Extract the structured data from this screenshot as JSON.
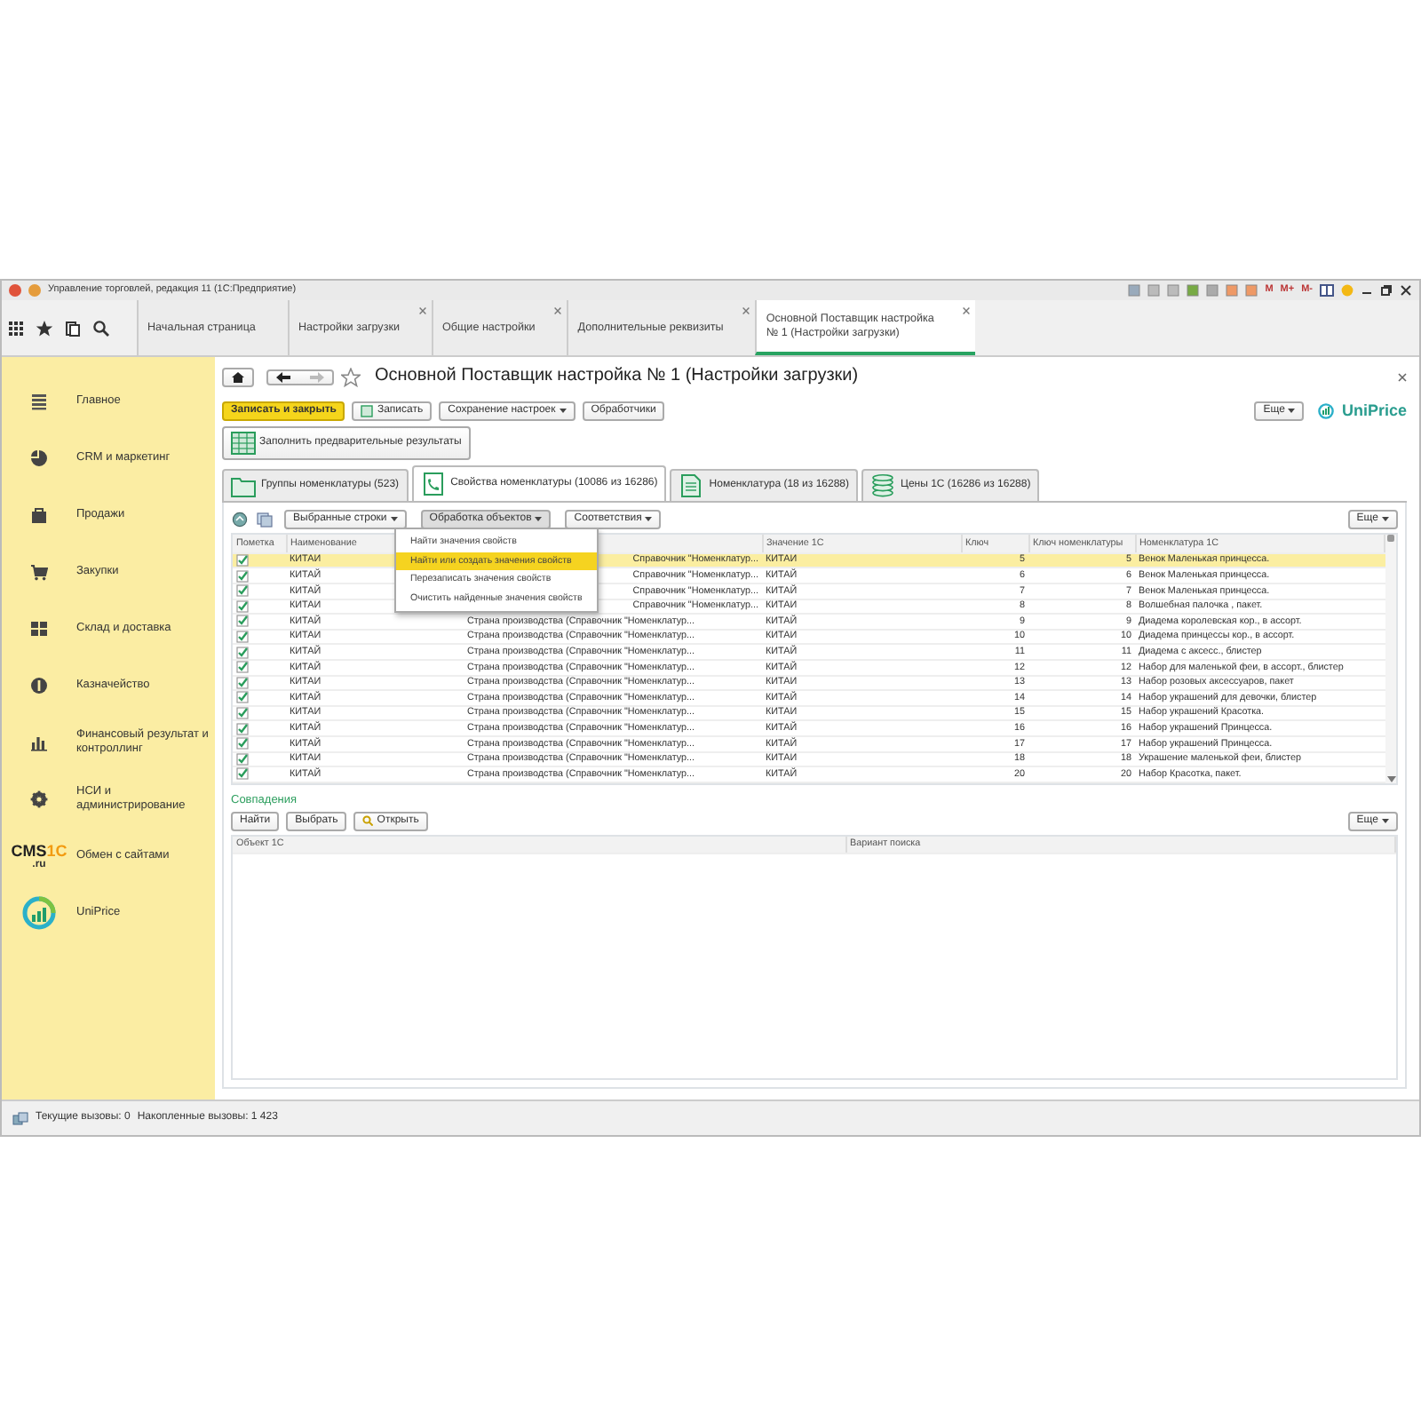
{
  "window": {
    "title": "Управление торговлей, редакция 11  (1С:Предприятие)",
    "tools": [
      "M",
      "M+",
      "M-"
    ]
  },
  "tabs": [
    {
      "label": "Начальная страница",
      "selected": false,
      "closable": false
    },
    {
      "label": "Настройки загрузки",
      "selected": false,
      "closable": true
    },
    {
      "label": "Общие настройки",
      "selected": false,
      "closable": true
    },
    {
      "label": "Дополнительные реквизиты",
      "selected": false,
      "closable": true
    },
    {
      "label": "Основной Поставщик настройка № 1 (Настройки загрузки)",
      "selected": true,
      "closable": true
    }
  ],
  "sidebar": {
    "items": [
      {
        "label": "Главное",
        "kind": "list"
      },
      {
        "label": "CRM и маркетинг",
        "kind": "pie"
      },
      {
        "label": "Продажи",
        "kind": "bag"
      },
      {
        "label": "Закупки",
        "kind": "cart"
      },
      {
        "label": "Склад и доставка",
        "kind": "grid"
      },
      {
        "label": "Казначейство",
        "kind": "coin"
      },
      {
        "label": "Финансовый результат и контроллинг",
        "kind": "bars"
      },
      {
        "label": "НСИ и администрирование",
        "kind": "gear"
      },
      {
        "label": "Обмен с сайтами",
        "kind": "cms",
        "logo": {
          "main": "CMS",
          "accent": "1C",
          "sub": ".ru"
        }
      },
      {
        "label": "UniPrice",
        "kind": "uniprice"
      }
    ]
  },
  "form": {
    "title": "Основной Поставщик настройка № 1 (Настройки загрузки)",
    "buttons": [
      {
        "label": "Записать и закрыть",
        "kind": "primary"
      },
      {
        "label": "Записать",
        "kind": "save"
      },
      {
        "label": "Сохранение настроек",
        "kind": "dropdown"
      },
      {
        "label": "Обработчики",
        "kind": "plain"
      }
    ],
    "more": "Еще",
    "brand": "UniPrice",
    "fill_button": "Заполнить предварительные результаты",
    "inner_tabs": [
      {
        "label": "Группы номенклатуры (523)",
        "kind": "folder",
        "selected": false
      },
      {
        "label": "Свойства номенклатуры (10086 из 16286)",
        "kind": "phone",
        "selected": true
      },
      {
        "label": "Номенклатура (18 из 16288)",
        "kind": "doc",
        "selected": false
      },
      {
        "label": "Цены 1С (16286 из 16288)",
        "kind": "coins",
        "selected": false
      }
    ]
  },
  "table_toolbar": {
    "buttons": [
      {
        "label": "Выбранные строки",
        "pressed": false
      },
      {
        "label": "Обработка объектов",
        "pressed": true
      },
      {
        "label": "Соответствия",
        "pressed": false
      }
    ],
    "more": "Еще"
  },
  "menu": {
    "items": [
      {
        "label": "Найти значения свойств",
        "selected": false
      },
      {
        "label": "Найти или создать значения свойств",
        "selected": true
      },
      {
        "label": "Перезаписать значения свойств",
        "selected": false
      },
      {
        "label": "Очистить найденные значения свойств",
        "selected": false
      }
    ]
  },
  "table": {
    "columns": [
      "Пометка",
      "Наименование",
      "",
      "Значение 1С",
      "Ключ",
      "Ключ номенклатуры",
      "Номенклатура 1С"
    ],
    "rows": [
      {
        "checked": true,
        "selected": true,
        "name": "КИТАЙ",
        "column_3": "Справочник \"Номенклатур...",
        "covered": true,
        "value": "КИТАЙ",
        "key": "5",
        "nom_key": "5",
        "nom": "Венок Маленькая принцесса."
      },
      {
        "checked": true,
        "selected": false,
        "name": "КИТАЙ",
        "column_3": "Справочник \"Номенклатур...",
        "covered": true,
        "value": "КИТАЙ",
        "key": "6",
        "nom_key": "6",
        "nom": "Венок Маленькая принцесса."
      },
      {
        "checked": true,
        "selected": false,
        "name": "КИТАЙ",
        "column_3": "Справочник \"Номенклатур...",
        "covered": true,
        "value": "КИТАЙ",
        "key": "7",
        "nom_key": "7",
        "nom": "Венок Маленькая принцесса."
      },
      {
        "checked": true,
        "selected": false,
        "name": "КИТАЙ",
        "column_3": "Справочник \"Номенклатур...",
        "covered": true,
        "value": "КИТАЙ",
        "key": "8",
        "nom_key": "8",
        "nom": "Волшебная палочка , пакет."
      },
      {
        "checked": true,
        "selected": false,
        "name": "КИТАЙ",
        "column_3": "Страна производства (Справочник \"Номенклатур...",
        "covered": false,
        "value": "КИТАЙ",
        "key": "9",
        "nom_key": "9",
        "nom": "Диадема королевская кор., в ассорт."
      },
      {
        "checked": true,
        "selected": false,
        "name": "КИТАЙ",
        "column_3": "Страна производства (Справочник \"Номенклатур...",
        "covered": false,
        "value": "КИТАЙ",
        "key": "10",
        "nom_key": "10",
        "nom": "Диадема принцессы кор., в ассорт."
      },
      {
        "checked": true,
        "selected": false,
        "name": "КИТАЙ",
        "column_3": "Страна производства (Справочник \"Номенклатур...",
        "covered": false,
        "value": "КИТАЙ",
        "key": "11",
        "nom_key": "11",
        "nom": "Диадема с аксесс., блистер"
      },
      {
        "checked": true,
        "selected": false,
        "name": "КИТАЙ",
        "column_3": "Страна производства (Справочник \"Номенклатур...",
        "covered": false,
        "value": "КИТАЙ",
        "key": "12",
        "nom_key": "12",
        "nom": "Набор для маленькой феи, в ассорт., блистер"
      },
      {
        "checked": true,
        "selected": false,
        "name": "КИТАЙ",
        "column_3": "Страна производства (Справочник \"Номенклатур...",
        "covered": false,
        "value": "КИТАЙ",
        "key": "13",
        "nom_key": "13",
        "nom": "Набор розовых аксессуаров, пакет"
      },
      {
        "checked": true,
        "selected": false,
        "name": "КИТАЙ",
        "column_3": "Страна производства (Справочник \"Номенклатур...",
        "covered": false,
        "value": "КИТАЙ",
        "key": "14",
        "nom_key": "14",
        "nom": "Набор украшений для девочки, блистер"
      },
      {
        "checked": true,
        "selected": false,
        "name": "КИТАЙ",
        "column_3": "Страна производства (Справочник \"Номенклатур...",
        "covered": false,
        "value": "КИТАЙ",
        "key": "15",
        "nom_key": "15",
        "nom": "Набор украшений Красотка."
      },
      {
        "checked": true,
        "selected": false,
        "name": "КИТАЙ",
        "column_3": "Страна производства (Справочник \"Номенклатур...",
        "covered": false,
        "value": "КИТАЙ",
        "key": "16",
        "nom_key": "16",
        "nom": "Набор украшений Принцесса."
      },
      {
        "checked": true,
        "selected": false,
        "name": "КИТАЙ",
        "column_3": "Страна производства (Справочник \"Номенклатур...",
        "covered": false,
        "value": "КИТАЙ",
        "key": "17",
        "nom_key": "17",
        "nom": "Набор украшений Принцесса."
      },
      {
        "checked": true,
        "selected": false,
        "name": "КИТАЙ",
        "column_3": "Страна производства (Справочник \"Номенклатур...",
        "covered": false,
        "value": "КИТАЙ",
        "key": "18",
        "nom_key": "18",
        "nom": "Украшение маленькой феи, блистер"
      },
      {
        "checked": true,
        "selected": false,
        "name": "КИТАЙ",
        "column_3": "Страна производства (Справочник \"Номенклатур...",
        "covered": false,
        "value": "КИТАЙ",
        "key": "20",
        "nom_key": "20",
        "nom": "Набор Красотка, пакет."
      }
    ]
  },
  "matches": {
    "title": "Совпадения",
    "buttons": [
      {
        "label": "Найти",
        "kind": "plain"
      },
      {
        "label": "Выбрать",
        "kind": "plain"
      },
      {
        "label": "Открыть",
        "kind": "search"
      }
    ],
    "more": "Еще",
    "columns": [
      "Объект 1С",
      "Вариант поиска"
    ]
  },
  "status_bar": {
    "current": "Текущие вызовы: 0",
    "accumulated": "Накопленные вызовы: 1 423"
  }
}
